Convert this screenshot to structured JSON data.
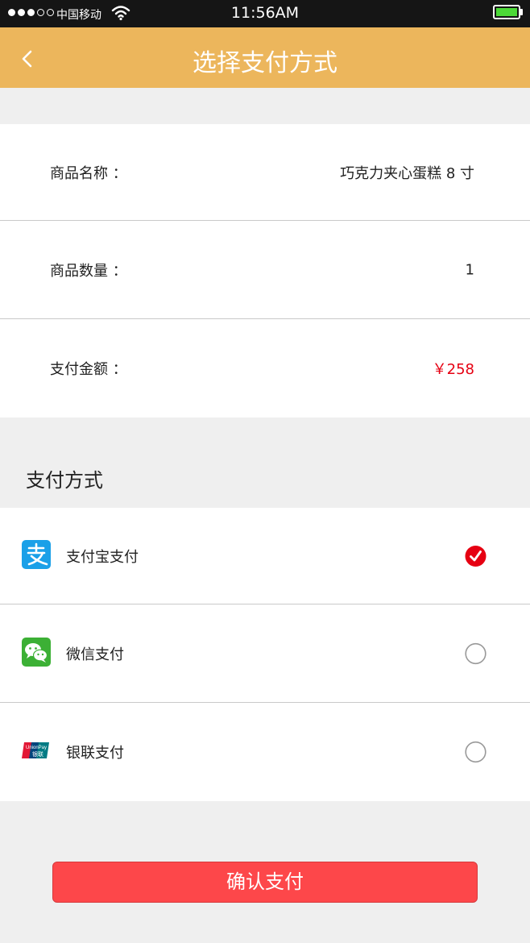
{
  "status_bar": {
    "carrier": "中国移动",
    "time": "11:56AM",
    "battery_color": "#4cd937"
  },
  "nav": {
    "title": "选择支付方式",
    "back_icon": "chevron-left-icon",
    "background": "#ecb65c"
  },
  "order": {
    "name_label": "商品名称 ：",
    "name_value": "巧克力夹心蛋糕 8 寸",
    "quantity_label": "商品数量 ：",
    "quantity_value": "1",
    "amount_label": "支付金额 ：",
    "amount_value": "￥258",
    "amount_color": "#e60012"
  },
  "payment": {
    "section_title": "支付方式",
    "methods": [
      {
        "label": "支付宝支付",
        "icon": "alipay-icon",
        "selected": true
      },
      {
        "label": "微信支付",
        "icon": "wechat-icon",
        "selected": false
      },
      {
        "label": "银联支付",
        "icon": "unionpay-icon",
        "selected": false
      }
    ]
  },
  "confirm_button": {
    "label": "确认支付",
    "color": "#fd474a"
  },
  "unionpay_logo": {
    "text_top": "UnionPay",
    "text_bottom": "银联"
  }
}
